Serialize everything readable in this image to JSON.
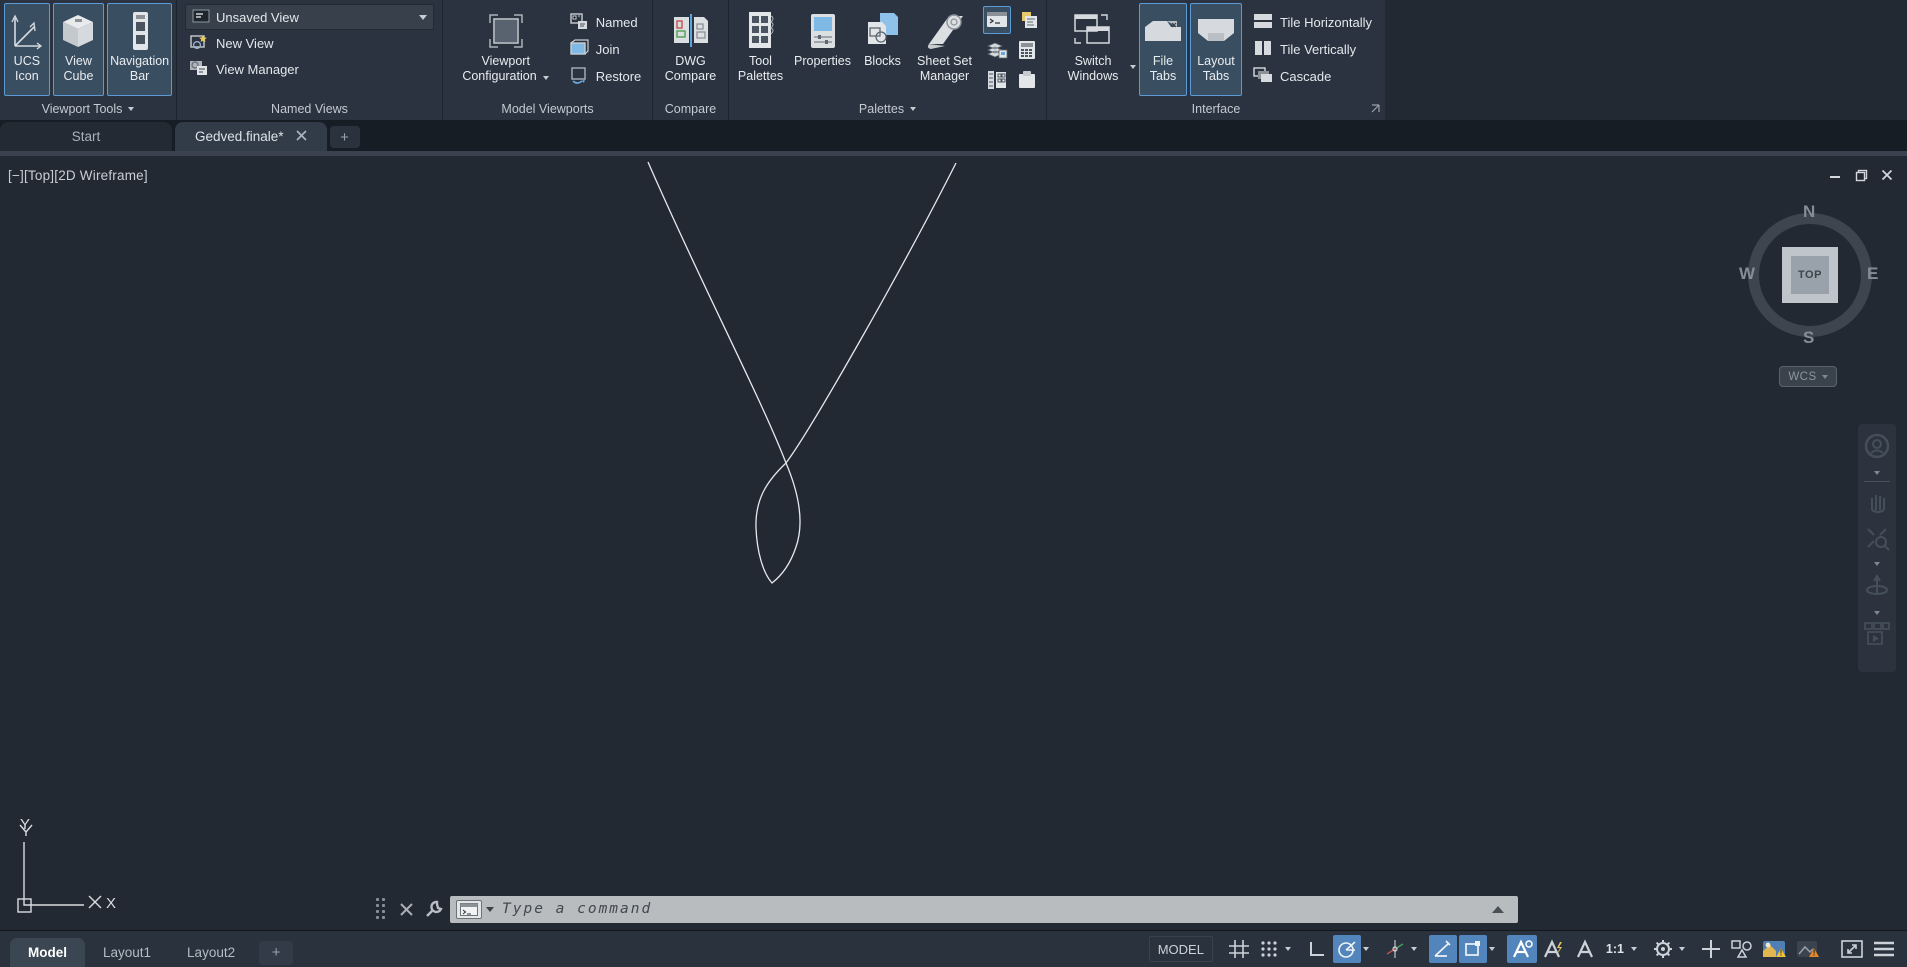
{
  "colors": {
    "accent": "#5b9bd5",
    "status_active": "#5185bb",
    "ribbon_bg": "#2a333f",
    "canvas_bg": "#222933"
  },
  "ribbon": {
    "panels": [
      {
        "label": "Viewport Tools",
        "buttons": [
          {
            "line1": "UCS",
            "line2": "Icon"
          },
          {
            "line1": "View",
            "line2": "Cube"
          },
          {
            "line1": "Navigation",
            "line2": "Bar"
          }
        ]
      },
      {
        "label": "Named Views",
        "combo": {
          "value": "Unsaved View"
        },
        "items": [
          {
            "label": "New View"
          },
          {
            "label": "View Manager"
          }
        ]
      },
      {
        "label": "Model Viewports",
        "big": {
          "line1": "Viewport",
          "line2": "Configuration"
        },
        "items": [
          {
            "label": "Named"
          },
          {
            "label": "Join"
          },
          {
            "label": "Restore"
          }
        ]
      },
      {
        "label": "Compare",
        "big": {
          "line1": "DWG",
          "line2": "Compare"
        }
      },
      {
        "label": "Palettes",
        "bigs": [
          {
            "line1": "Tool",
            "line2": "Palettes"
          },
          {
            "line1": "Properties",
            "line2": ""
          },
          {
            "line1": "Blocks",
            "line2": ""
          },
          {
            "line1": "Sheet Set",
            "line2": "Manager"
          }
        ],
        "small_icons": [
          "command-line",
          "design-center",
          "layer-stack",
          "quick-calc",
          "count",
          "clipboard"
        ]
      },
      {
        "label": "Interface",
        "bigs": [
          {
            "line1": "Switch",
            "line2": "Windows"
          },
          {
            "line1": "File",
            "line2": "Tabs"
          },
          {
            "line1": "Layout",
            "line2": "Tabs"
          }
        ],
        "items": [
          {
            "label": "Tile Horizontally"
          },
          {
            "label": "Tile Vertically"
          },
          {
            "label": "Cascade"
          }
        ]
      }
    ]
  },
  "file_tab_bar": {
    "tabs": [
      {
        "label": "Start"
      },
      {
        "label": "Gedved.finale*"
      }
    ],
    "add_glyph": "+"
  },
  "drawing": {
    "viewport_label": "[−][Top][2D Wireframe]",
    "window_control_icons": [
      "minimize-icon",
      "restore-icon",
      "close-icon"
    ],
    "ucs": {
      "x": "X",
      "y": "Y"
    }
  },
  "viewcube": {
    "north": "N",
    "south": "S",
    "east": "E",
    "west": "W",
    "face": "TOP",
    "wcs_label": "WCS"
  },
  "command_bar": {
    "placeholder": "Type a command"
  },
  "layout_tabs": {
    "tabs": [
      {
        "label": "Model"
      },
      {
        "label": "Layout1"
      },
      {
        "label": "Layout2"
      }
    ],
    "add_glyph": "+"
  },
  "status_bar": {
    "model_label": "MODEL",
    "scale_label": "1:1",
    "icons": [
      "grid",
      "snap",
      "ortho",
      "polar-tracking",
      "isodraft",
      "object-snap-tracking",
      "object-snap",
      "annotation-visibility",
      "annotation-autoscale",
      "annotation-scale",
      "workspace-gear",
      "tray-crosshair",
      "isolate-objects",
      "hardware-acceleration",
      "graphics-warning",
      "clean-screen",
      "customization-menu"
    ]
  }
}
